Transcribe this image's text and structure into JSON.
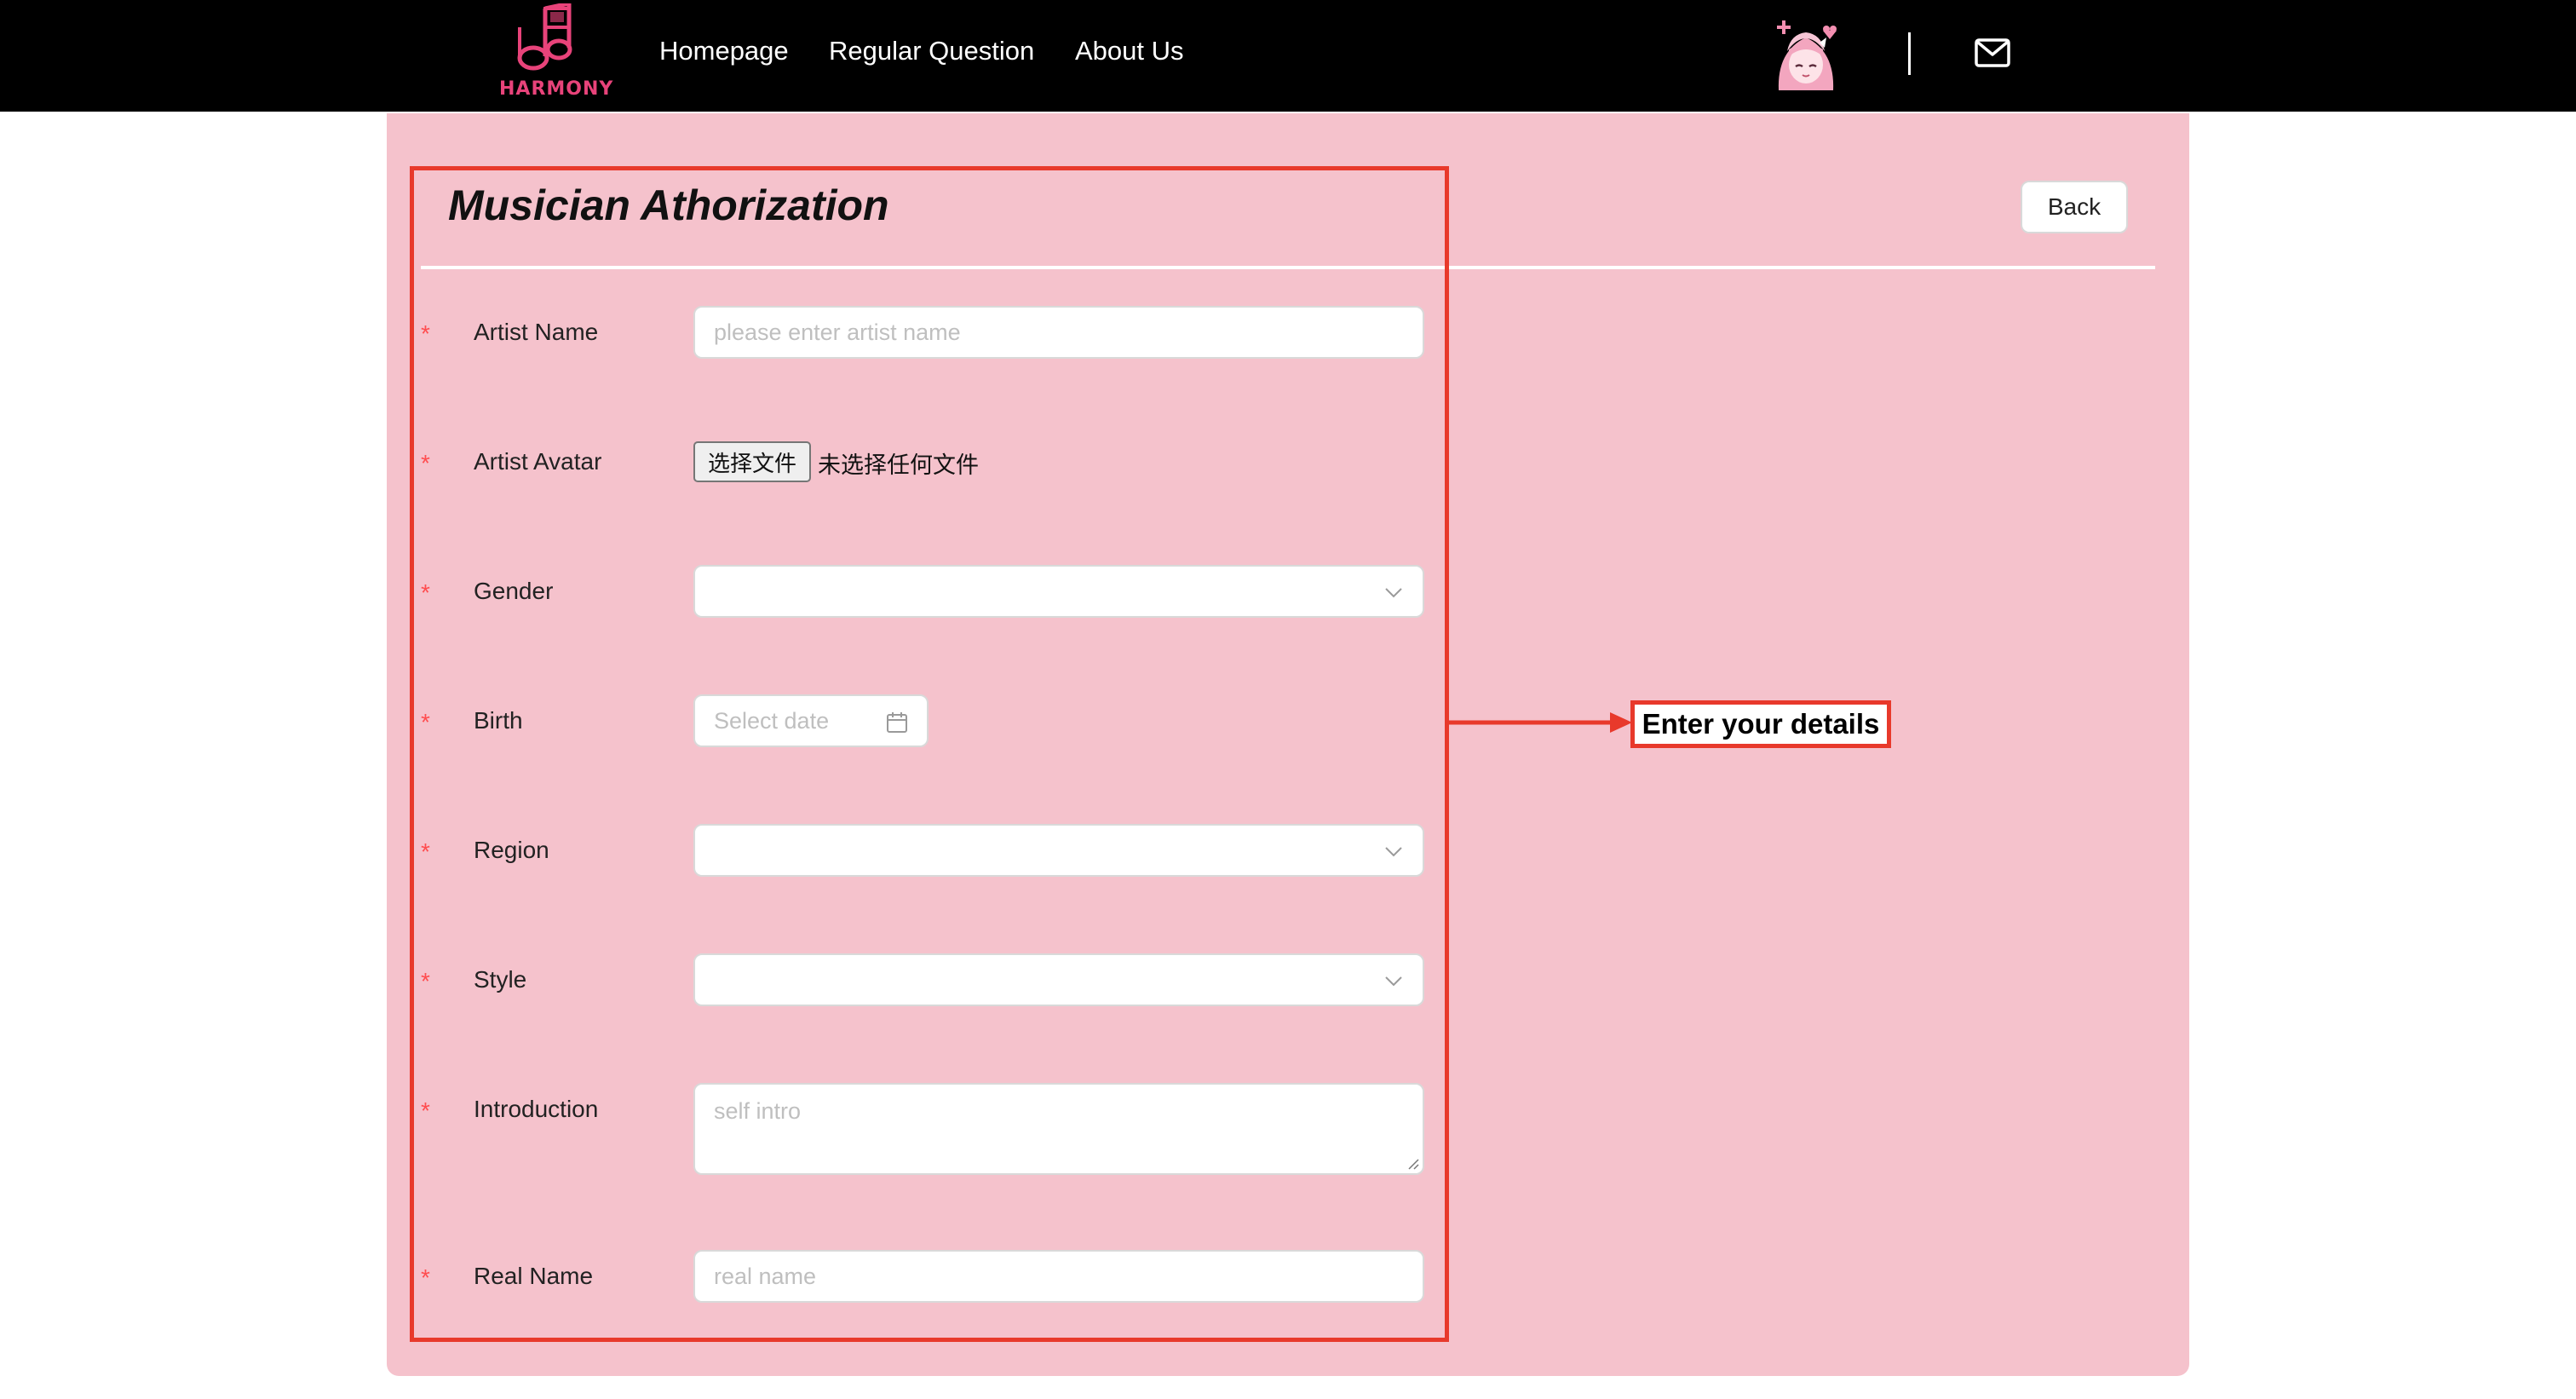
{
  "navbar": {
    "logo_text": "HARMONY",
    "links": [
      "Homepage",
      "Regular Question",
      "About Us"
    ],
    "avatar_icon": "anime-avatar-icon",
    "mail_icon": "mail-icon"
  },
  "page": {
    "title": "Musician Athorization",
    "back_label": "Back"
  },
  "form": {
    "required_mark": "*",
    "artist_name": {
      "label": "Artist Name",
      "placeholder": "please enter artist name"
    },
    "artist_avatar": {
      "label": "Artist Avatar",
      "button_label": "选择文件",
      "status": "未选择任何文件"
    },
    "gender": {
      "label": "Gender",
      "value": ""
    },
    "birth": {
      "label": "Birth",
      "placeholder": "Select date"
    },
    "region": {
      "label": "Region",
      "value": ""
    },
    "style": {
      "label": "Style",
      "value": ""
    },
    "introduction": {
      "label": "Introduction",
      "placeholder": "self intro"
    },
    "real_name": {
      "label": "Real Name",
      "placeholder": "real name"
    }
  },
  "annotation": {
    "label": "Enter your details",
    "color": "#e8392b"
  },
  "colors": {
    "navbar_bg": "#000000",
    "card_bg": "#f5c2cc",
    "brand_pink": "#e8437a",
    "required_red": "#ff4d4f"
  }
}
